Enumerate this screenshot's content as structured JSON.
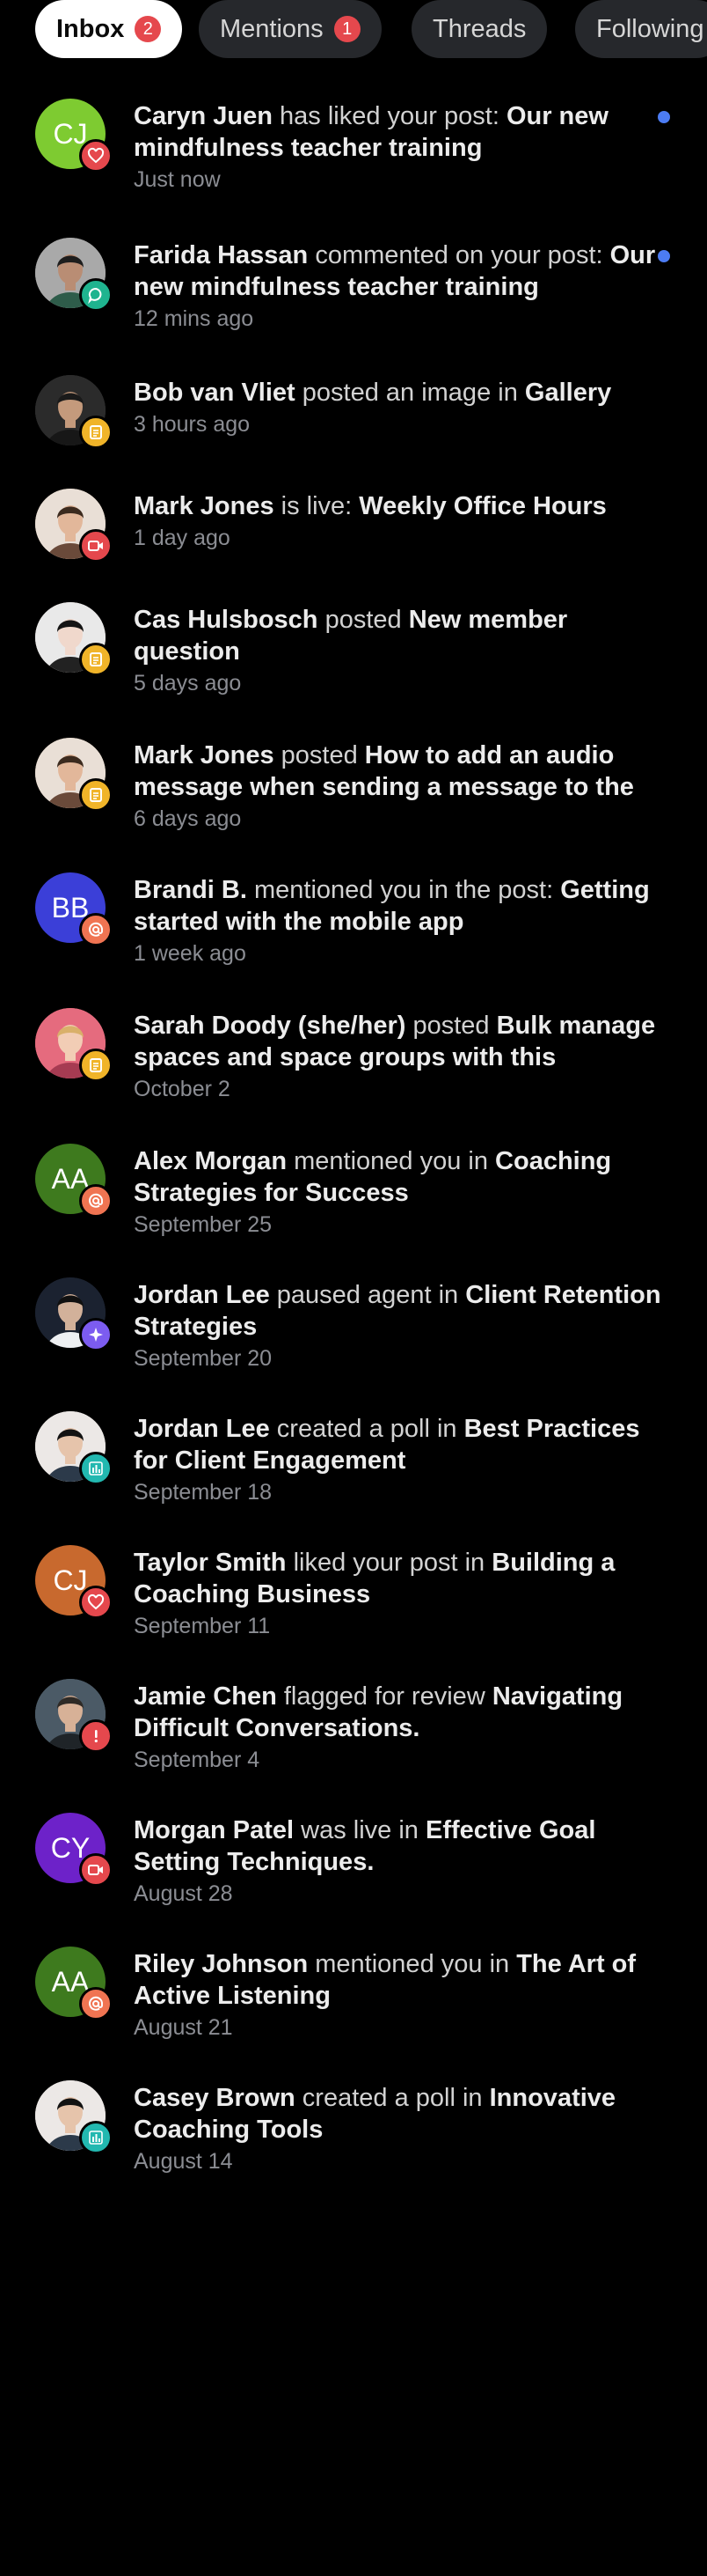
{
  "tabs": [
    {
      "label": "Inbox",
      "badge": "2",
      "active": true
    },
    {
      "label": "Mentions",
      "badge": "1",
      "active": false
    },
    {
      "label": "Threads",
      "badge": "",
      "active": false
    },
    {
      "label": "Following",
      "badge": "",
      "active": false
    }
  ],
  "notifications": [
    {
      "avatar_initials": "CJ",
      "avatar_color": "#7ecb31",
      "icon": "heart-icon",
      "icon_color": "#e5484d",
      "actor": "Caryn Juen",
      "action": "has liked your post:",
      "target": "Our new mindfulness teacher training",
      "time": "Just now",
      "unread": true
    },
    {
      "avatar_initials": "",
      "avatar_color": "#8a8a8a",
      "icon": "comment-icon",
      "icon_color": "#1fb48f",
      "actor": "Farida Hassan",
      "action": "commented on your post:",
      "target": "Our new mindfulness teacher training",
      "time": "12 mins ago",
      "unread": true
    },
    {
      "avatar_initials": "",
      "avatar_color": "#3a3a3a",
      "icon": "post-icon",
      "icon_color": "#f0b429",
      "actor": "Bob van Vliet",
      "action": "posted an image in",
      "target": "Gallery",
      "time": "3 hours ago",
      "unread": false
    },
    {
      "avatar_initials": "",
      "avatar_color": "#c9a98a",
      "icon": "video-icon",
      "icon_color": "#e5484d",
      "actor": "Mark Jones",
      "action": "is live:",
      "target": "Weekly Office Hours",
      "time": "1 day ago",
      "unread": false
    },
    {
      "avatar_initials": "",
      "avatar_color": "#d8c8c0",
      "icon": "post-icon",
      "icon_color": "#f0b429",
      "actor": "Cas Hulsbosch",
      "action": "posted",
      "target": "New member question",
      "time": "5 days ago",
      "unread": false
    },
    {
      "avatar_initials": "",
      "avatar_color": "#c9a98a",
      "icon": "post-icon",
      "icon_color": "#f0b429",
      "actor": "Mark Jones",
      "action": "posted",
      "target": "How to add an audio message when sending a message to the",
      "time": "6 days ago",
      "unread": false
    },
    {
      "avatar_initials": "BB",
      "avatar_color": "#3b3fd8",
      "icon": "mention-icon",
      "icon_color": "#f07452",
      "actor": "Brandi B.",
      "action": "mentioned you in the post:",
      "target": "Getting started with the mobile app",
      "time": "1 week ago",
      "unread": false
    },
    {
      "avatar_initials": "",
      "avatar_color": "#e86a7a",
      "icon": "post-icon",
      "icon_color": "#f0b429",
      "actor": "Sarah Doody (she/her)",
      "action": "posted",
      "target": "Bulk manage spaces and space groups with this",
      "time": "October 2",
      "unread": false
    },
    {
      "avatar_initials": "AA",
      "avatar_color": "#3e7a1e",
      "icon": "mention-icon",
      "icon_color": "#f07452",
      "actor": "Alex Morgan",
      "action": "mentioned you in",
      "target": "Coaching Strategies for Success",
      "time": "September 25",
      "unread": false
    },
    {
      "avatar_initials": "",
      "avatar_color": "#1b2230",
      "icon": "sparkle-icon",
      "icon_color": "#7c5cf0",
      "actor": "Jordan Lee",
      "action": "paused agent in",
      "target": "Client Retention Strategies",
      "time": "September 20",
      "unread": false
    },
    {
      "avatar_initials": "",
      "avatar_color": "#e8e4e2",
      "icon": "poll-icon",
      "icon_color": "#22b8b0",
      "actor": "Jordan Lee",
      "action": "created a poll in",
      "target": "Best Practices for Client Engagement",
      "time": "September 18",
      "unread": false
    },
    {
      "avatar_initials": "CJ",
      "avatar_color": "#c8692e",
      "icon": "heart-icon",
      "icon_color": "#e5484d",
      "actor": "Taylor Smith",
      "action": "liked your post in",
      "target": "Building a Coaching Business",
      "time": "September 11",
      "unread": false
    },
    {
      "avatar_initials": "",
      "avatar_color": "#5b6b78",
      "icon": "flag-icon",
      "icon_color": "#e5484d",
      "actor": "Jamie Chen",
      "action": "flagged for review",
      "target": "Navigating Difficult Conversations.",
      "time": "September 4",
      "unread": false
    },
    {
      "avatar_initials": "CY",
      "avatar_color": "#6d22c9",
      "icon": "video-icon",
      "icon_color": "#e5484d",
      "actor": "Morgan Patel",
      "action": "was live in",
      "target": "Effective Goal Setting Techniques.",
      "time": "August 28",
      "unread": false
    },
    {
      "avatar_initials": "AA",
      "avatar_color": "#3e7a1e",
      "icon": "mention-icon",
      "icon_color": "#f07452",
      "actor": "Riley Johnson",
      "action": "mentioned you in",
      "target": "The Art of Active Listening",
      "time": "August 21",
      "unread": false
    },
    {
      "avatar_initials": "",
      "avatar_color": "#e8e4e2",
      "icon": "poll-icon",
      "icon_color": "#22b8b0",
      "actor": "Casey Brown",
      "action": "created a poll in",
      "target": "Innovative Coaching Tools",
      "time": "August 14",
      "unread": false
    }
  ]
}
